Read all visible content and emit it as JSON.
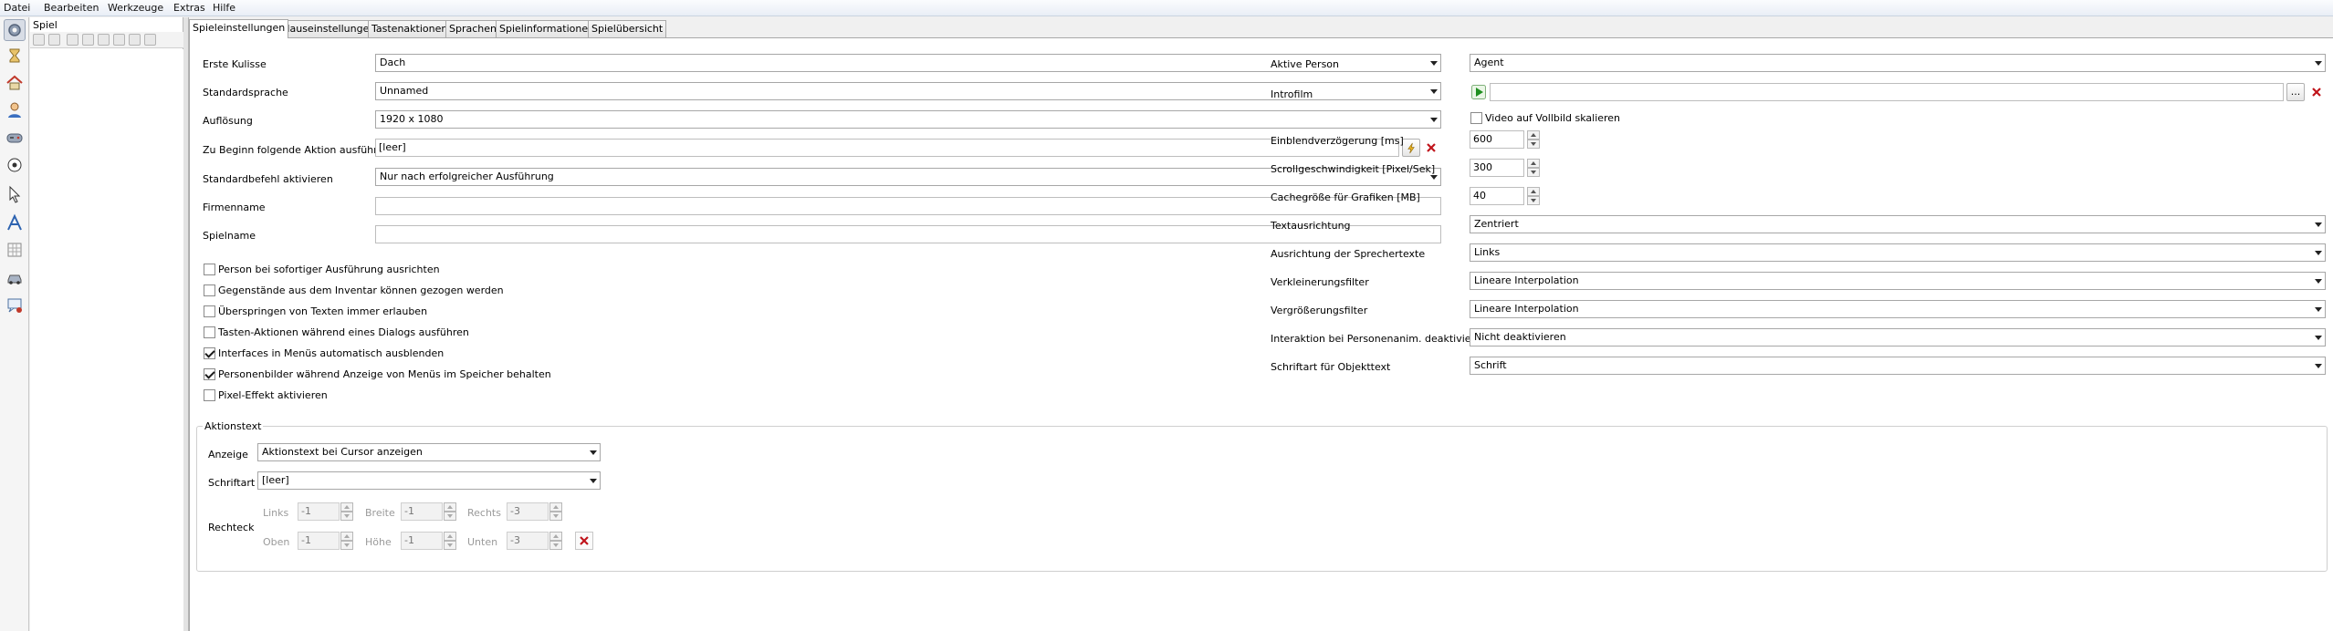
{
  "menu": {
    "items": [
      "Datei",
      "Bearbeiten",
      "Werkzeuge",
      "Extras",
      "Hilfe"
    ]
  },
  "tree": {
    "title": "Spiel"
  },
  "tabs": [
    "Spieleinstellungen",
    "Mauseinstellungen",
    "Tastenaktionen",
    "Sprachen",
    "Spielinformationen",
    "Spielübersicht"
  ],
  "left": {
    "erste_kulisse": {
      "label": "Erste Kulisse",
      "value": "Dach"
    },
    "standardsprache": {
      "label": "Standardsprache",
      "value": "Unnamed"
    },
    "aufloesung": {
      "label": "Auflösung",
      "value": "1920 x 1080"
    },
    "beginn_aktion": {
      "label": "Zu Beginn folgende Aktion ausführen",
      "value": "[leer]"
    },
    "standardbefehl": {
      "label": "Standardbefehl aktivieren",
      "value": "Nur nach erfolgreicher Ausführung"
    },
    "firmenname": {
      "label": "Firmenname",
      "value": ""
    },
    "spielname": {
      "label": "Spielname",
      "value": ""
    },
    "checkboxes": [
      {
        "label": "Person bei sofortiger Ausführung ausrichten",
        "checked": false
      },
      {
        "label": "Gegenstände aus dem Inventar können gezogen werden",
        "checked": false
      },
      {
        "label": "Überspringen von Texten immer erlauben",
        "checked": false
      },
      {
        "label": "Tasten-Aktionen während eines Dialogs ausführen",
        "checked": false
      },
      {
        "label": "Interfaces in Menüs automatisch ausblenden",
        "checked": true
      },
      {
        "label": "Personenbilder während Anzeige von Menüs im Speicher behalten",
        "checked": true
      },
      {
        "label": "Pixel-Effekt aktivieren",
        "checked": false
      }
    ]
  },
  "right": {
    "aktive_person": {
      "label": "Aktive Person",
      "value": "Agent"
    },
    "introfilm": {
      "label": "Introfilm",
      "value": "",
      "browse": "..."
    },
    "video_skalieren": {
      "label": "Video auf Vollbild skalieren",
      "checked": false
    },
    "einblend": {
      "label": "Einblendverzögerung [ms]",
      "value": "600"
    },
    "scroll": {
      "label": "Scrollgeschwindigkeit [Pixel/Sek]",
      "value": "300"
    },
    "cache": {
      "label": "Cachegröße für Grafiken [MB]",
      "value": "40"
    },
    "textausrichtung": {
      "label": "Textausrichtung",
      "value": "Zentriert"
    },
    "sprechertexte": {
      "label": "Ausrichtung der Sprechertexte",
      "value": "Links"
    },
    "verkleinerung": {
      "label": "Verkleinerungsfilter",
      "value": "Lineare Interpolation"
    },
    "vergroesserung": {
      "label": "Vergrößerungsfilter",
      "value": "Lineare Interpolation"
    },
    "interaktion": {
      "label": "Interaktion bei Personenanim. deaktivieren",
      "value": "Nicht deaktivieren"
    },
    "schriftart_obj": {
      "label": "Schriftart für Objekttext",
      "value": "Schrift"
    }
  },
  "aktionstext": {
    "title": "Aktionstext",
    "anzeige": {
      "label": "Anzeige",
      "value": "Aktionstext bei Cursor anzeigen"
    },
    "schriftart": {
      "label": "Schriftart",
      "value": "[leer]"
    },
    "rechteck": {
      "label": "Rechteck",
      "links": {
        "label": "Links",
        "value": "-1"
      },
      "breite": {
        "label": "Breite",
        "value": "-1"
      },
      "rechts": {
        "label": "Rechts",
        "value": "-3"
      },
      "oben": {
        "label": "Oben",
        "value": "-1"
      },
      "hoehe": {
        "label": "Höhe",
        "value": "-1"
      },
      "unten": {
        "label": "Unten",
        "value": "-3"
      }
    }
  },
  "icons": {
    "left_toolbar": [
      "gear-icon",
      "hourglass-icon",
      "home-icon",
      "person-icon",
      "gamepad-icon",
      "ball-icon",
      "cursor-icon",
      "font-icon",
      "grid-icon",
      "car-icon",
      "dialog-icon"
    ],
    "accent_red": "#c0141b",
    "accent_green": "#1f8f1f"
  }
}
